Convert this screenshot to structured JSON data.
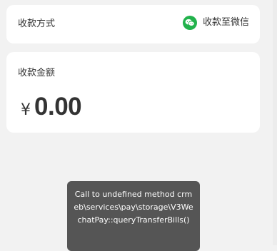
{
  "payment_method": {
    "label": "收款方式",
    "value": "收款至微信",
    "icon": "wechat-icon"
  },
  "amount": {
    "label": "收款金额",
    "currency_symbol": "¥",
    "value": "0.00"
  },
  "toast": {
    "message": "Call to undefined method crmeb\\services\\pay\\storage\\V3WechatPay::queryTransferBills()"
  },
  "colors": {
    "background": "#f2f2f2",
    "card": "#ffffff",
    "text": "#333333",
    "wechat_green": "#22b24c",
    "toast_bg": "#555555"
  }
}
